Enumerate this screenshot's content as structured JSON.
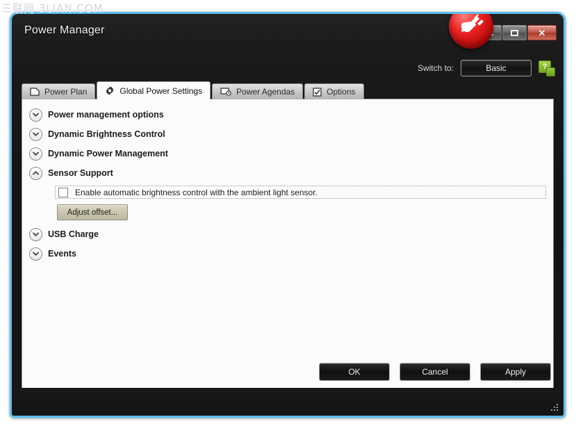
{
  "watermark": "三联网 3LIAN.COM",
  "window": {
    "title": "Power Manager",
    "logo_icon": "power-plug-icon",
    "controls": {
      "minimize": "minimize-icon",
      "maximize": "maximize-icon",
      "close": "✕"
    }
  },
  "switch_bar": {
    "label": "Switch to:",
    "mode_button": "Basic",
    "help_icon": "help-question-icon",
    "help_glyph": "?"
  },
  "tabs": [
    {
      "label": "Power Plan",
      "icon": "page-icon",
      "active": false
    },
    {
      "label": "Global Power Settings",
      "icon": "gear-icon",
      "active": true
    },
    {
      "label": "Power Agendas",
      "icon": "monitor-clock-icon",
      "active": false
    },
    {
      "label": "Options",
      "icon": "checkbox-icon",
      "active": false
    }
  ],
  "sections": [
    {
      "title": "Power management options",
      "expanded": false,
      "chevron": "chevron-down-icon"
    },
    {
      "title": "Dynamic Brightness Control",
      "expanded": false,
      "chevron": "chevron-down-icon"
    },
    {
      "title": "Dynamic Power Management",
      "expanded": false,
      "chevron": "chevron-down-icon"
    },
    {
      "title": "Sensor Support",
      "expanded": true,
      "chevron": "chevron-up-icon"
    },
    {
      "title": "USB Charge",
      "expanded": false,
      "chevron": "chevron-down-icon"
    },
    {
      "title": "Events",
      "expanded": false,
      "chevron": "chevron-down-icon"
    }
  ],
  "sensor_support": {
    "checkbox_label": "Enable automatic brightness control with the ambient light sensor.",
    "checkbox_checked": false,
    "adjust_button": "Adjust offset..."
  },
  "footer": {
    "ok": "OK",
    "cancel": "Cancel",
    "apply": "Apply",
    "resize_grip": "resize-grip-icon"
  },
  "colors": {
    "window_border": "#5bc0ef",
    "chrome_dark": "#1a1a1a",
    "content_bg": "#fbfbfb",
    "logo_red": "#e02121",
    "help_green": "#8cc63f",
    "button_khaki": "#c9c5ae"
  }
}
